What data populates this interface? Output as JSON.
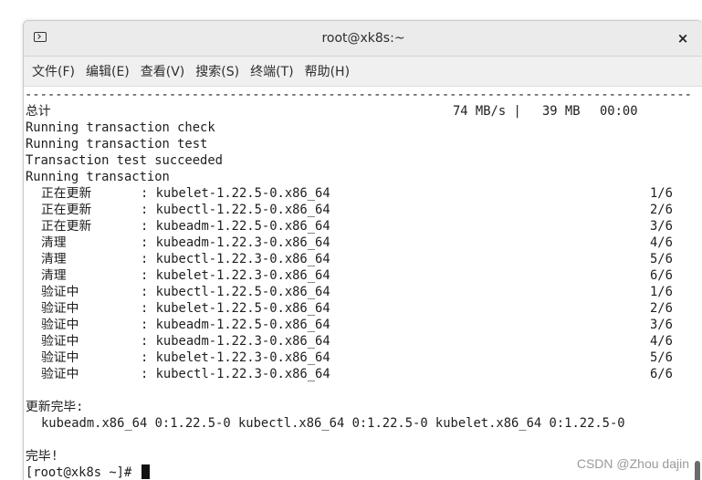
{
  "window": {
    "title": "root@xk8s:~",
    "close_label": "×"
  },
  "menu": [
    "文件(F)",
    "编辑(E)",
    "查看(V)",
    "搜索(S)",
    "终端(T)",
    "帮助(H)"
  ],
  "terminal": {
    "separator": "--------------------------------------------------------------------------------------------------------------------------------",
    "total": {
      "label": "总计",
      "speed": "74 MB/s |",
      "size": "39 MB",
      "time": "00:00"
    },
    "messages": [
      "Running transaction check",
      "Running transaction test",
      "Transaction test succeeded",
      "Running transaction"
    ],
    "steps": [
      {
        "action": "正在更新",
        "package": ": kubelet-1.22.5-0.x86_64",
        "progress": "1/6"
      },
      {
        "action": "正在更新",
        "package": ": kubectl-1.22.5-0.x86_64",
        "progress": "2/6"
      },
      {
        "action": "正在更新",
        "package": ": kubeadm-1.22.5-0.x86_64",
        "progress": "3/6"
      },
      {
        "action": "清理",
        "package": ": kubeadm-1.22.3-0.x86_64",
        "progress": "4/6"
      },
      {
        "action": "清理",
        "package": ": kubectl-1.22.3-0.x86_64",
        "progress": "5/6"
      },
      {
        "action": "清理",
        "package": ": kubelet-1.22.3-0.x86_64",
        "progress": "6/6"
      },
      {
        "action": "验证中",
        "package": ": kubectl-1.22.5-0.x86_64",
        "progress": "1/6"
      },
      {
        "action": "验证中",
        "package": ": kubelet-1.22.5-0.x86_64",
        "progress": "2/6"
      },
      {
        "action": "验证中",
        "package": ": kubeadm-1.22.5-0.x86_64",
        "progress": "3/6"
      },
      {
        "action": "验证中",
        "package": ": kubeadm-1.22.3-0.x86_64",
        "progress": "4/6"
      },
      {
        "action": "验证中",
        "package": ": kubelet-1.22.3-0.x86_64",
        "progress": "5/6"
      },
      {
        "action": "验证中",
        "package": ": kubectl-1.22.3-0.x86_64",
        "progress": "6/6"
      }
    ],
    "updated_label": "更新完毕:",
    "updated_packages": "kubeadm.x86_64 0:1.22.5-0 kubectl.x86_64 0:1.22.5-0 kubelet.x86_64 0:1.22.5-0",
    "done_label": "完毕!",
    "prompt": "[root@xk8s ~]# "
  },
  "watermark": "CSDN @Zhou dajin"
}
